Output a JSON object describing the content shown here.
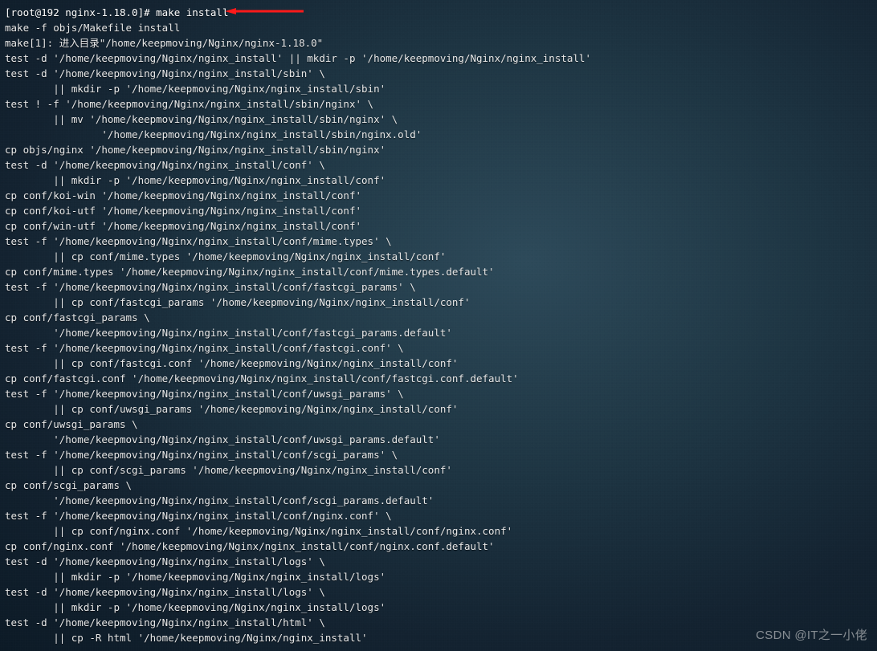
{
  "prompt": "[root@192 nginx-1.18.0]# ",
  "command": "make install",
  "annotation": {
    "arrow_color": "#ff0000",
    "arrow_points_to": "make install"
  },
  "watermark": "CSDN @IT之一小佬",
  "output_lines": [
    "make -f objs/Makefile install",
    "make[1]: 进入目录\"/home/keepmoving/Nginx/nginx-1.18.0\"",
    "test -d '/home/keepmoving/Nginx/nginx_install' || mkdir -p '/home/keepmoving/Nginx/nginx_install'",
    "test -d '/home/keepmoving/Nginx/nginx_install/sbin' \\",
    "        || mkdir -p '/home/keepmoving/Nginx/nginx_install/sbin'",
    "test ! -f '/home/keepmoving/Nginx/nginx_install/sbin/nginx' \\",
    "        || mv '/home/keepmoving/Nginx/nginx_install/sbin/nginx' \\",
    "                '/home/keepmoving/Nginx/nginx_install/sbin/nginx.old'",
    "cp objs/nginx '/home/keepmoving/Nginx/nginx_install/sbin/nginx'",
    "test -d '/home/keepmoving/Nginx/nginx_install/conf' \\",
    "        || mkdir -p '/home/keepmoving/Nginx/nginx_install/conf'",
    "cp conf/koi-win '/home/keepmoving/Nginx/nginx_install/conf'",
    "cp conf/koi-utf '/home/keepmoving/Nginx/nginx_install/conf'",
    "cp conf/win-utf '/home/keepmoving/Nginx/nginx_install/conf'",
    "test -f '/home/keepmoving/Nginx/nginx_install/conf/mime.types' \\",
    "        || cp conf/mime.types '/home/keepmoving/Nginx/nginx_install/conf'",
    "cp conf/mime.types '/home/keepmoving/Nginx/nginx_install/conf/mime.types.default'",
    "test -f '/home/keepmoving/Nginx/nginx_install/conf/fastcgi_params' \\",
    "        || cp conf/fastcgi_params '/home/keepmoving/Nginx/nginx_install/conf'",
    "cp conf/fastcgi_params \\",
    "        '/home/keepmoving/Nginx/nginx_install/conf/fastcgi_params.default'",
    "test -f '/home/keepmoving/Nginx/nginx_install/conf/fastcgi.conf' \\",
    "        || cp conf/fastcgi.conf '/home/keepmoving/Nginx/nginx_install/conf'",
    "cp conf/fastcgi.conf '/home/keepmoving/Nginx/nginx_install/conf/fastcgi.conf.default'",
    "test -f '/home/keepmoving/Nginx/nginx_install/conf/uwsgi_params' \\",
    "        || cp conf/uwsgi_params '/home/keepmoving/Nginx/nginx_install/conf'",
    "cp conf/uwsgi_params \\",
    "        '/home/keepmoving/Nginx/nginx_install/conf/uwsgi_params.default'",
    "test -f '/home/keepmoving/Nginx/nginx_install/conf/scgi_params' \\",
    "        || cp conf/scgi_params '/home/keepmoving/Nginx/nginx_install/conf'",
    "cp conf/scgi_params \\",
    "        '/home/keepmoving/Nginx/nginx_install/conf/scgi_params.default'",
    "test -f '/home/keepmoving/Nginx/nginx_install/conf/nginx.conf' \\",
    "        || cp conf/nginx.conf '/home/keepmoving/Nginx/nginx_install/conf/nginx.conf'",
    "cp conf/nginx.conf '/home/keepmoving/Nginx/nginx_install/conf/nginx.conf.default'",
    "test -d '/home/keepmoving/Nginx/nginx_install/logs' \\",
    "        || mkdir -p '/home/keepmoving/Nginx/nginx_install/logs'",
    "test -d '/home/keepmoving/Nginx/nginx_install/logs' \\",
    "        || mkdir -p '/home/keepmoving/Nginx/nginx_install/logs'",
    "test -d '/home/keepmoving/Nginx/nginx_install/html' \\",
    "        || cp -R html '/home/keepmoving/Nginx/nginx_install'"
  ]
}
